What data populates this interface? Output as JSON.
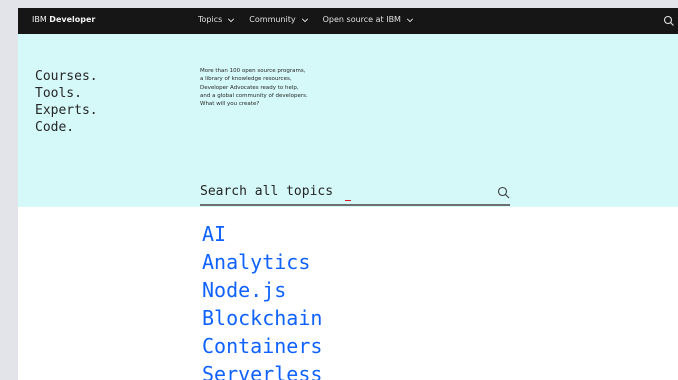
{
  "header": {
    "brand_prefix": "IBM",
    "brand_name": "Developer",
    "nav": [
      {
        "label": "Topics"
      },
      {
        "label": "Community"
      },
      {
        "label": "Open source at IBM"
      }
    ],
    "search_icon": "search-icon"
  },
  "hero": {
    "tagline": [
      "Courses.",
      "Tools.",
      "Experts.",
      "Code."
    ],
    "intro": [
      "More than 100 open source programs,",
      "a library of  knowledge resources,",
      "Developer Advocates ready to help,",
      "and a global community of developers.",
      "What will you create?"
    ]
  },
  "search": {
    "value": "Search all topics"
  },
  "topics": [
    "AI",
    "Analytics",
    "Node.js",
    "Blockchain",
    "Containers",
    "Serverless"
  ],
  "colors": {
    "header_bg": "#161616",
    "hero_bg": "#d5f8f8",
    "link": "#0f62fe",
    "cursor": "#da1e28"
  }
}
